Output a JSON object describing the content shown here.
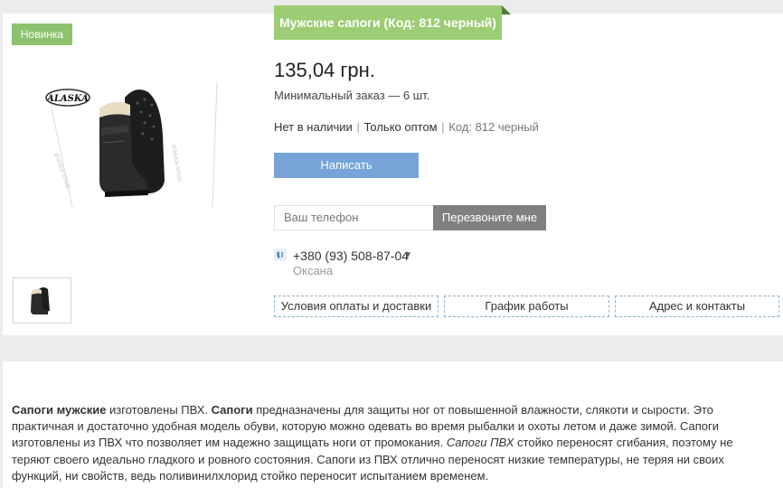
{
  "product": {
    "badge": "Новинка",
    "title": "Мужские сапоги (Код: 812 черный)",
    "price": "135,04 грн.",
    "min_order": "Минимальный заказ — 6 шт.",
    "availability": "Нет в наличии",
    "sale_type": "Только оптом",
    "code": "Код: 812 черный",
    "photo_brand": "ALASKA"
  },
  "actions": {
    "write_label": "Написать",
    "phone_placeholder": "Ваш телефон",
    "callback_label": "Перезвоните мне"
  },
  "contact": {
    "phone": "+380 (93) 508-87-04",
    "name": "Оксана"
  },
  "tabs": [
    {
      "label": "Условия оплаты и доставки"
    },
    {
      "label": "График работы"
    },
    {
      "label": "Адрес и контакты"
    }
  ],
  "description": {
    "b1": "Сапоги мужские",
    "t1": " изготовлены  ПВХ. ",
    "b2": "Сапоги",
    "t2": " предназначены для защиты ног от повышенной влажности, слякоти и сырости. Это практичная и достаточно удобная модель обуви, которую можно одевать во время рыбалки и охоты летом и даже зимой.   Сапоги изготовлены из ПВХ что  позволяет им надежно защищать ноги от промокания. ",
    "i1": "Сапоги ПВХ",
    "t3": "  стойко переносят сгибания, поэтому не теряют своего идеально гладкого и ровного состояния. Сапоги из ПВХ  отлично переносят низкие температуры, не теряя ни своих функций, ни свойств, ведь поливинилхлорид стойко переносит испытанием временем."
  }
}
